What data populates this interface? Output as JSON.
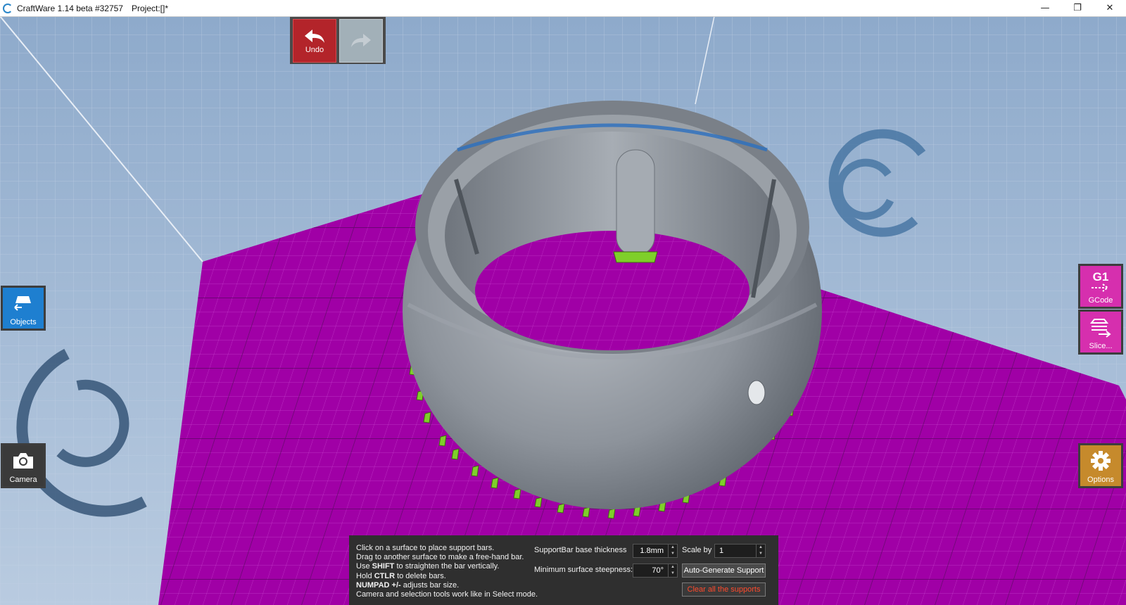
{
  "window": {
    "title": "CraftWare 1.14 beta #32757",
    "project": "Project:[]*",
    "minimize": "—",
    "restore": "❐",
    "close": "✕"
  },
  "toolbar": {
    "undo_label": "Undo",
    "redo_label": ""
  },
  "left_panel": {
    "objects_label": "Objects",
    "camera_label": "Camera"
  },
  "right_panel": {
    "gcode_top": "G1",
    "gcode_label": "GCode",
    "slice_label": "Slice...",
    "options_label": "Options"
  },
  "support_panel": {
    "help_lines": [
      {
        "pre": "Click on a surface to place support bars.",
        "bold": "",
        "post": ""
      },
      {
        "pre": "Drag to another surface to make a free-hand bar.",
        "bold": "",
        "post": ""
      },
      {
        "pre": "Use ",
        "bold": "SHIFT",
        "post": " to straighten the bar vertically."
      },
      {
        "pre": "Hold ",
        "bold": "CTLR",
        "post": " to delete bars."
      },
      {
        "pre": "",
        "bold": "NUMPAD +/-",
        "post": " adjusts bar size."
      },
      {
        "pre": "Camera and selection tools work like in Select mode.",
        "bold": "",
        "post": ""
      }
    ],
    "base_thickness_label": "SupportBar base thickness",
    "base_thickness_value": "1.8mm",
    "scale_label": "Scale by",
    "scale_value": "1",
    "steepness_label": "Minimum surface steepness:",
    "steepness_value": "70°",
    "auto_generate_label": "Auto-Generate Support",
    "clear_label": "Clear all the supports"
  },
  "colors": {
    "bed": "#a000a6",
    "model": "#8e949c",
    "support": "#7fcf2a",
    "undo": "#b3242a",
    "gcode": "#d62fae",
    "options": "#c68a2c",
    "objects": "#1e7fd0"
  }
}
